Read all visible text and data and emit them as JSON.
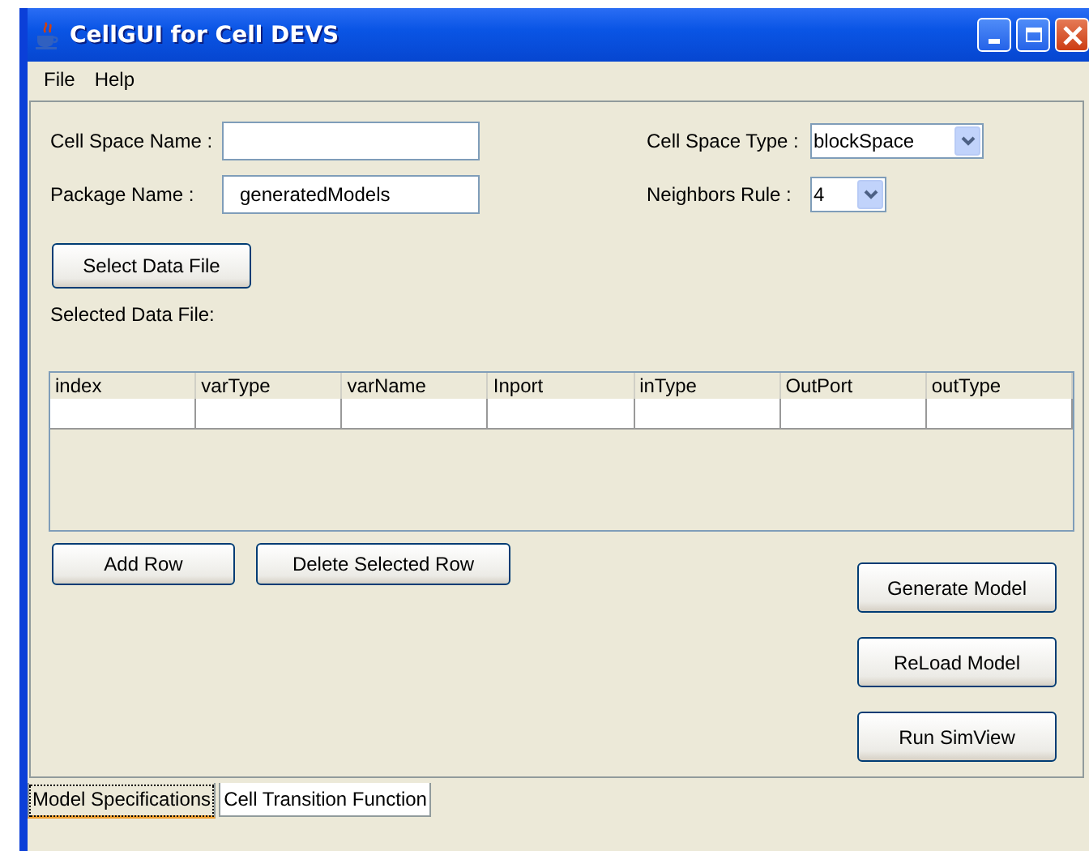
{
  "window": {
    "title": "CellGUI for Cell DEVS"
  },
  "menu": [
    "File",
    "Help"
  ],
  "fields_left": [
    {
      "label": "Cell Space Name :",
      "kind": "text"
    },
    {
      "label": "Package Name :",
      "kind": "text",
      "value": "generatedModels"
    }
  ],
  "fields_right": [
    {
      "label": "Cell Space Type :",
      "kind": "combo",
      "value": "blockSpace"
    },
    {
      "label": "Neighbors Rule :",
      "kind": "combo",
      "value": "4"
    }
  ],
  "select_button": "Select Data File",
  "selected_file_label": "Selected Data File:",
  "table": {
    "columns": [
      "index",
      "varType",
      "varName",
      "Inport",
      "inType",
      "OutPort",
      "outType"
    ]
  },
  "row_buttons": [
    "Add Row",
    "Delete Selected Row"
  ],
  "action_buttons": [
    "Generate Model",
    "ReLoad Model",
    "Run SimView"
  ],
  "tabs": [
    {
      "label": "Model Specifications",
      "selected": true
    },
    {
      "label": "Cell Transition Function",
      "selected": false
    }
  ]
}
